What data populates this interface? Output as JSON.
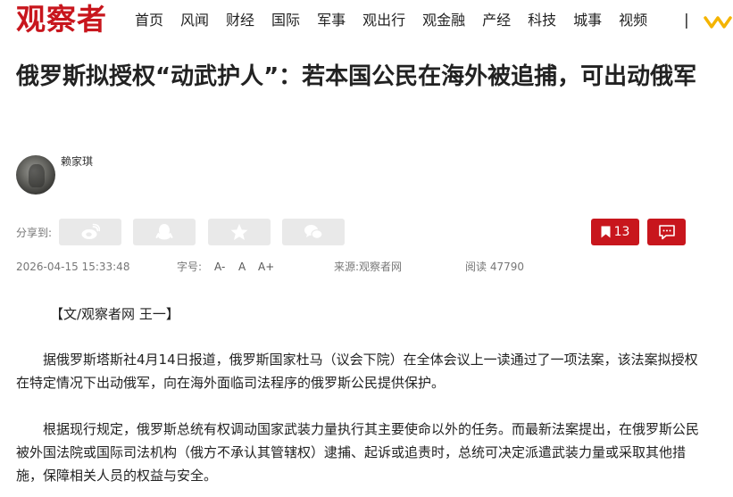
{
  "site": {
    "logo": "观察者"
  },
  "nav": {
    "items": [
      "首页",
      "风闻",
      "财经",
      "国际",
      "军事",
      "观出行",
      "观金融",
      "产经",
      "科技",
      "城事",
      "视频"
    ],
    "separator": "|"
  },
  "article": {
    "title": "俄罗斯拟授权“动武护人”：若本国公民在海外被追捕，可出动俄军",
    "author": "赖家琪",
    "share_label": "分享到:",
    "bookmark_count": "13",
    "datetime": "2026-04-15 15:33:48",
    "font_size_label": "字号:",
    "font_small": "A-",
    "font_normal": "A",
    "font_large": "A+",
    "source": "来源:观察者网",
    "read_count": "阅读 47790",
    "byline": "【文/观察者网 王一】",
    "paragraphs": [
      "据俄罗斯塔斯社4月14日报道，俄罗斯国家杜马（议会下院）在全体会议上一读通过了一项法案，该法案拟授权在特定情况下出动俄军，向在海外面临司法程序的俄罗斯公民提供保护。",
      "根据现行规定，俄罗斯总统有权调动国家武装力量执行其主要使命以外的任务。而最新法案提出，在俄罗斯公民被外国法院或国际司法机构（俄方不承认其管辖权）逮捕、起诉或追责时，总统可决定派遣武装力量或采取其他措施，保障相关人员的权益与安全。"
    ]
  },
  "icons": [
    "weibo-icon",
    "qq-icon",
    "qzone-star-icon",
    "wechat-icon",
    "bookmark-icon",
    "comment-icon",
    "vip-crown-icon"
  ],
  "colors": {
    "brand_red": "#c8161d",
    "button_gray": "#e9e9e9",
    "meta_gray": "#777777",
    "crown_gold": "#f4b400"
  }
}
